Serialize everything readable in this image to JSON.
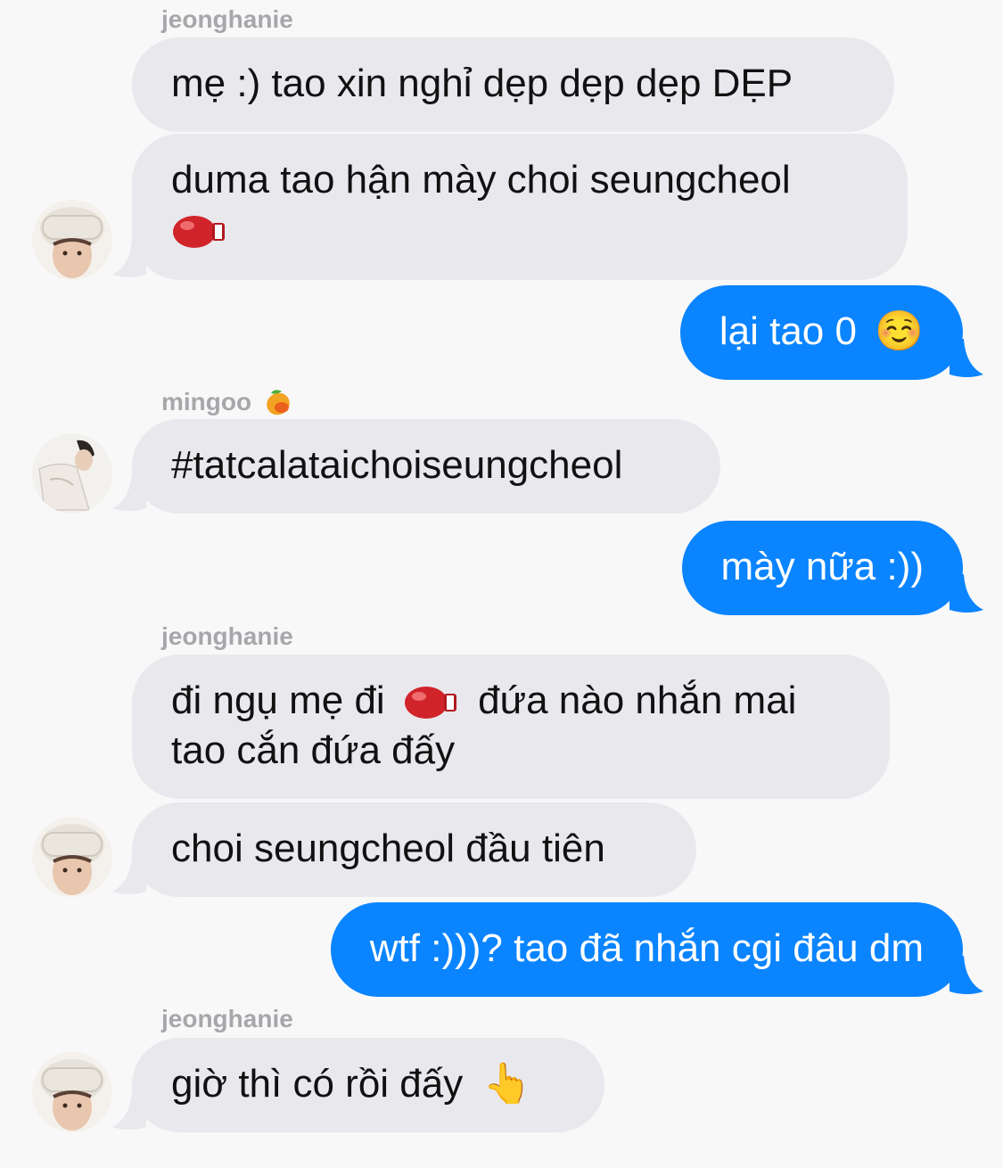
{
  "messages": [
    {
      "sender": "jeonghanie"
    },
    {
      "text": "mẹ :) tao xin nghỉ dẹp dẹp dẹp DẸP"
    },
    {
      "text_line1": "duma tao hận mày choi seungcheol",
      "emoji": "boxing-glove-icon"
    },
    {
      "text": "lại tao 0",
      "emoji": "☺️"
    },
    {
      "sender": "mingoo",
      "sender_emoji": "mango-icon"
    },
    {
      "text": "#tatcalataichoiseungcheol"
    },
    {
      "text": "mày nữa :))"
    },
    {
      "sender": "jeonghanie"
    },
    {
      "text_part1": "đi ngụ mẹ đi",
      "text_part2": "đứa nào nhắn mai",
      "text_line2": "tao cắn đứa đấy",
      "emoji": "boxing-glove-icon"
    },
    {
      "text": "choi seungcheol đầu tiên"
    },
    {
      "text": "wtf :)))? tao đã nhắn cgi đâu dm"
    },
    {
      "sender": "jeonghanie"
    },
    {
      "text": "giờ thì có rồi đấy",
      "emoji": "👆"
    }
  ],
  "colors": {
    "incoming": "#e9e8ed",
    "outgoing": "#0a84ff",
    "background": "#f8f8f9",
    "sender_label": "#a7a7ab"
  }
}
